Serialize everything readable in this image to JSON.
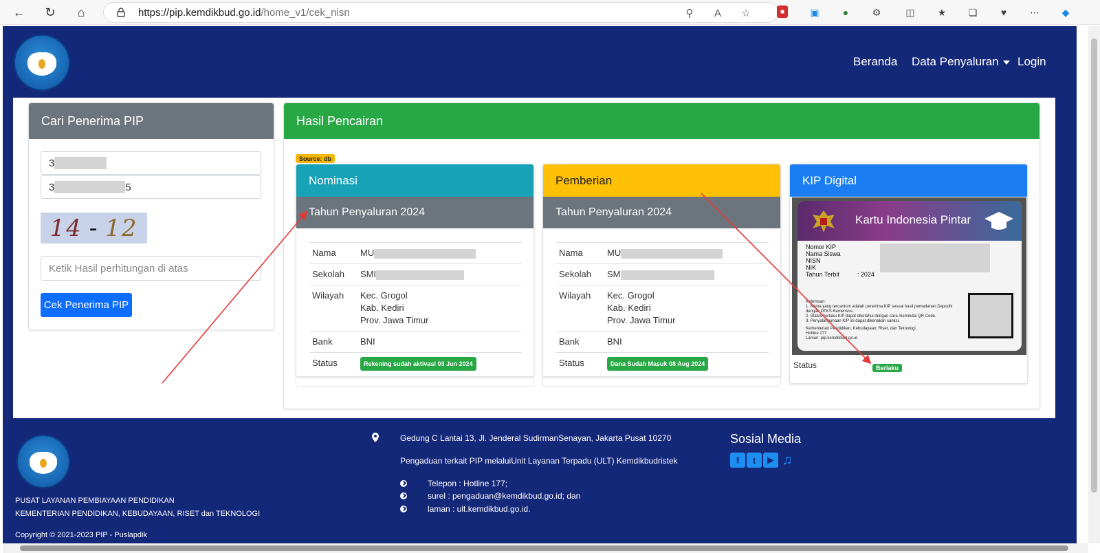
{
  "browser": {
    "url_host": "https://pip.kemdikbud.go.id",
    "url_path": "/home_v1/cek_nisn"
  },
  "navbar": {
    "beranda": "Beranda",
    "data_penyaluran": "Data Penyaluran",
    "login": "Login"
  },
  "search": {
    "title": "Cari Penerima PIP",
    "nisn_prefix": "3",
    "nik_prefix": "3",
    "nik_suffix": "5",
    "captcha_a": "14",
    "captcha_op": "-",
    "captcha_b": "12",
    "answer_placeholder": "Ketik Hasil perhitungan di atas",
    "button": "Cek Penerima PIP"
  },
  "results": {
    "title": "Hasil Pencairan",
    "source": "Source: db",
    "nominasi": {
      "title": "Nominasi",
      "year": "Tahun Penyaluran 2024",
      "nama_label": "Nama",
      "nama_value": "MU",
      "sekolah_label": "Sekolah",
      "sekolah_value": "SMI",
      "wilayah_label": "Wilayah",
      "kec": "Kec. Grogol",
      "kab": "Kab. Kediri",
      "prov": "Prov. Jawa Timur",
      "bank_label": "Bank",
      "bank_value": "BNI",
      "status_label": "Status",
      "status_value": "Rekening sudah aktivasi 03 Jun 2024"
    },
    "pemberian": {
      "title": "Pemberian",
      "year": "Tahun Penyaluran 2024",
      "nama_label": "Nama",
      "nama_value": "MU",
      "sekolah_label": "Sekolah",
      "sekolah_value": "SM",
      "wilayah_label": "Wilayah",
      "kec": "Kec. Grogol",
      "kab": "Kab. Kediri",
      "prov": "Prov. Jawa Timur",
      "bank_label": "Bank",
      "bank_value": "BNI",
      "status_label": "Status",
      "status_value": "Dana Sudah Masuk 08 Aug 2024"
    },
    "kip": {
      "title": "KIP Digital",
      "card_title": "Kartu Indonesia Pintar",
      "l1": "Nomor KIP",
      "l2": "Nama Siswa",
      "l3": "NISN",
      "l4": "NIK",
      "l5": "Tahun Terbit",
      "tahun_terbit": ": 2024",
      "notes_title": "Ketentuan:",
      "note1": "1. Nama yang tercantum adalah penerima KIP sesuai hasil pemadanan Dapodik dengan DTKS Kemensos.",
      "note2": "2. Status berlaku KIP dapat diketahui dengan cara memindai QR Code.",
      "note3": "3. Penyalahgunaan KIP ini dapat dikenakan sanksi.",
      "issuer": "Kementerian Pendidikan, Kebudayaan, Riset, dan Teknologi",
      "hotline": "Hotline 177",
      "laman": "Laman: pip.kemdikbud.go.id",
      "status_label": "Status",
      "status_value": "Berlaku"
    }
  },
  "footer": {
    "org1": "PUSAT LAYANAN PEMBIAYAAN PENDIDIKAN",
    "org2": "KEMENTERIAN PENDIDIKAN, KEBUDAYAAN, RISET dan TEKNOLOGI",
    "copyright": "Copyright © 2021-2023 PIP - Puslapdik",
    "address": "Gedung C Lantai 13, Jl. Jenderal SudirmanSenayan, Jakarta Pusat 10270",
    "complaint": "Pengaduan terkait PIP melaluiUnit Layanan Terpadu (ULT) Kemdikbudristek",
    "phone": "Telepon : Hotline 177;",
    "email": "surel : pengaduan@kemdikbud.go.id; dan",
    "web": "laman : ult.kemdikbud.go.id.",
    "social_title": "Sosial Media"
  },
  "colors": {
    "navy": "#14287a",
    "grey_header": "#6c757d",
    "green": "#28a745",
    "teal": "#17a2b8",
    "yellow": "#ffc107",
    "blue": "#0d6efd"
  }
}
